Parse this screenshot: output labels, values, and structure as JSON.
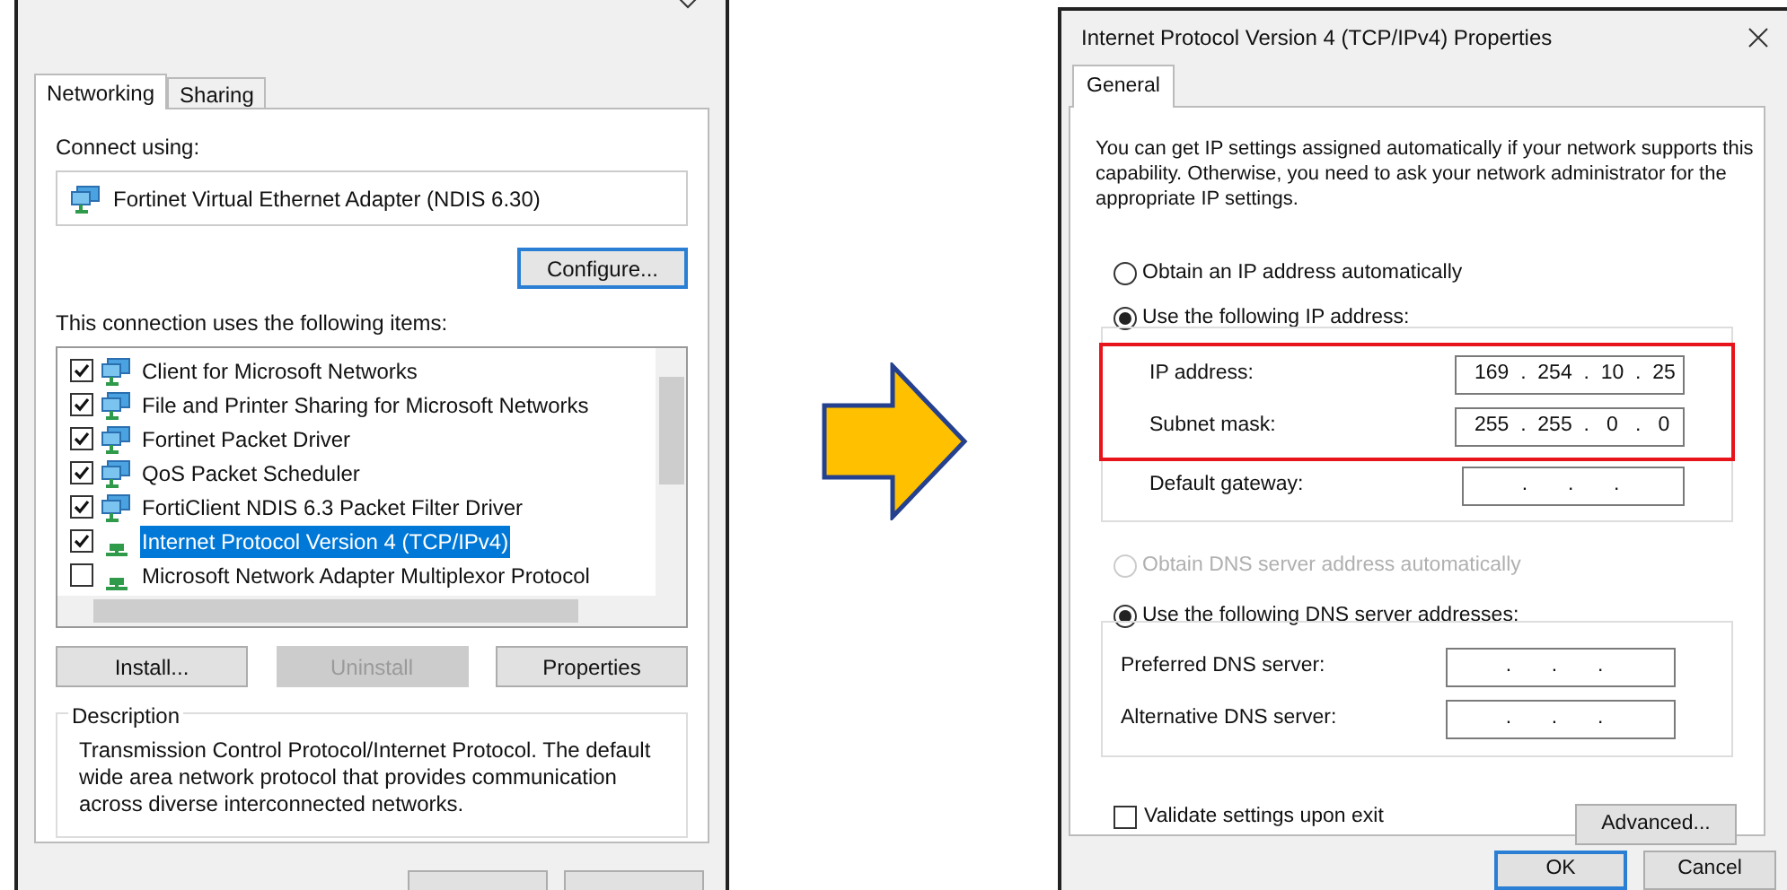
{
  "left_dialog": {
    "tabs": [
      {
        "label": "Networking",
        "selected": true
      },
      {
        "label": "Sharing",
        "selected": false
      }
    ],
    "connect_using_label": "Connect using:",
    "adapter": "Fortinet Virtual Ethernet Adapter (NDIS 6.30)",
    "configure_button": "Configure...",
    "items_label": "This connection uses the following items:",
    "items": [
      {
        "label": "Client for Microsoft Networks",
        "checked": true,
        "selected": false,
        "kind": "client"
      },
      {
        "label": "File and Printer Sharing for Microsoft Networks",
        "checked": true,
        "selected": false,
        "kind": "service"
      },
      {
        "label": "Fortinet Packet Driver",
        "checked": true,
        "selected": false,
        "kind": "service"
      },
      {
        "label": "QoS Packet Scheduler",
        "checked": true,
        "selected": false,
        "kind": "service"
      },
      {
        "label": "FortiClient NDIS 6.3 Packet Filter Driver",
        "checked": true,
        "selected": false,
        "kind": "service"
      },
      {
        "label": "Internet Protocol Version 4 (TCP/IPv4)",
        "checked": true,
        "selected": true,
        "kind": "protocol"
      },
      {
        "label": "Microsoft Network Adapter Multiplexor Protocol",
        "checked": false,
        "selected": false,
        "kind": "protocol"
      }
    ],
    "buttons": [
      {
        "label": "Install...",
        "disabled": false
      },
      {
        "label": "Uninstall",
        "disabled": true
      },
      {
        "label": "Properties",
        "disabled": false
      }
    ],
    "description_title": "Description",
    "description": "Transmission Control Protocol/Internet Protocol. The default wide area network protocol that provides communication across diverse interconnected networks."
  },
  "right_dialog": {
    "title": "Internet Protocol Version 4 (TCP/IPv4) Properties",
    "tabs": [
      {
        "label": "General",
        "selected": true
      }
    ],
    "intro": "You can get IP settings assigned automatically if your network supports this capability. Otherwise, you need to ask your network administrator for the appropriate IP settings.",
    "ip_radios": [
      {
        "label": "Obtain an IP address automatically",
        "selected": false,
        "disabled": false
      },
      {
        "label": "Use the following IP address:",
        "selected": true,
        "disabled": false
      }
    ],
    "ip_fields": [
      {
        "label": "IP address:",
        "value": "169  .  254  .  10  .  25",
        "highlighted": true
      },
      {
        "label": "Subnet mask:",
        "value": "255  .  255  .   0   .   0",
        "highlighted": true
      },
      {
        "label": "Default gateway:",
        "value": "       .       .       .",
        "highlighted": false
      }
    ],
    "dns_radios": [
      {
        "label": "Obtain DNS server address automatically",
        "selected": false,
        "disabled": true
      },
      {
        "label": "Use the following DNS server addresses:",
        "selected": true,
        "disabled": false
      }
    ],
    "dns_fields": [
      {
        "label": "Preferred DNS server:",
        "value": "       .       .       .",
        "highlighted": false
      },
      {
        "label": "Alternative DNS server:",
        "value": "       .       .       .",
        "highlighted": false
      }
    ],
    "validate": {
      "label": "Validate settings upon exit",
      "checked": false
    },
    "advanced_button": "Advanced...",
    "buttons": [
      {
        "label": "OK",
        "default": true
      },
      {
        "label": "Cancel",
        "default": false
      }
    ]
  }
}
